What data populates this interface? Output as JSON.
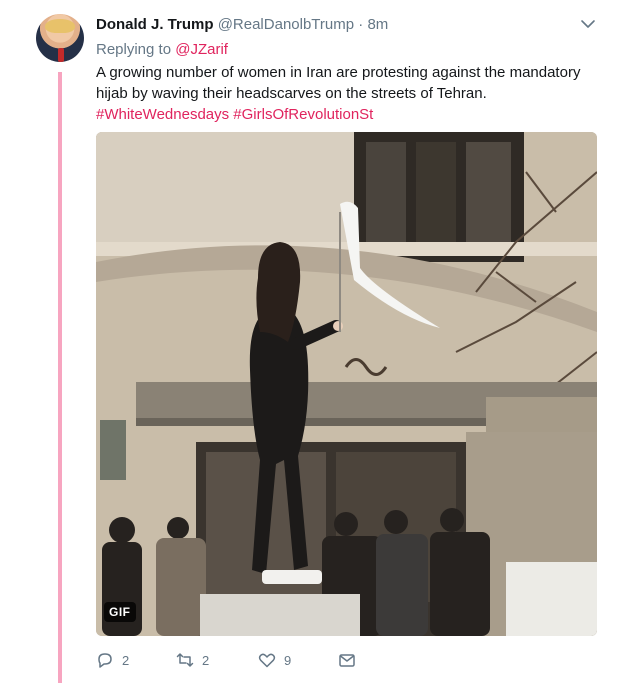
{
  "tweet": {
    "author_name": "Donald J. Trump",
    "handle": "@RealDanolbTrump",
    "separator": "·",
    "time": "8m",
    "replying_prefix": "Replying to",
    "replying_to": "@JZarif",
    "text": "A growing number of women in Iran are protesting against the mandatory hijab by waving their headscarves on the streets of Tehran.",
    "hashtags": [
      "#WhiteWednesdays",
      "#GirlsOfRevolutionSt"
    ],
    "media_badge": "GIF"
  },
  "actions": {
    "replies": "2",
    "retweets": "2",
    "likes": "9"
  },
  "colors": {
    "accent": "#e0245e",
    "thread_line": "#f7a5c0",
    "muted_text": "#657786"
  },
  "icons": [
    "chevron-down-icon",
    "reply-icon",
    "retweet-icon",
    "like-icon",
    "message-icon"
  ]
}
